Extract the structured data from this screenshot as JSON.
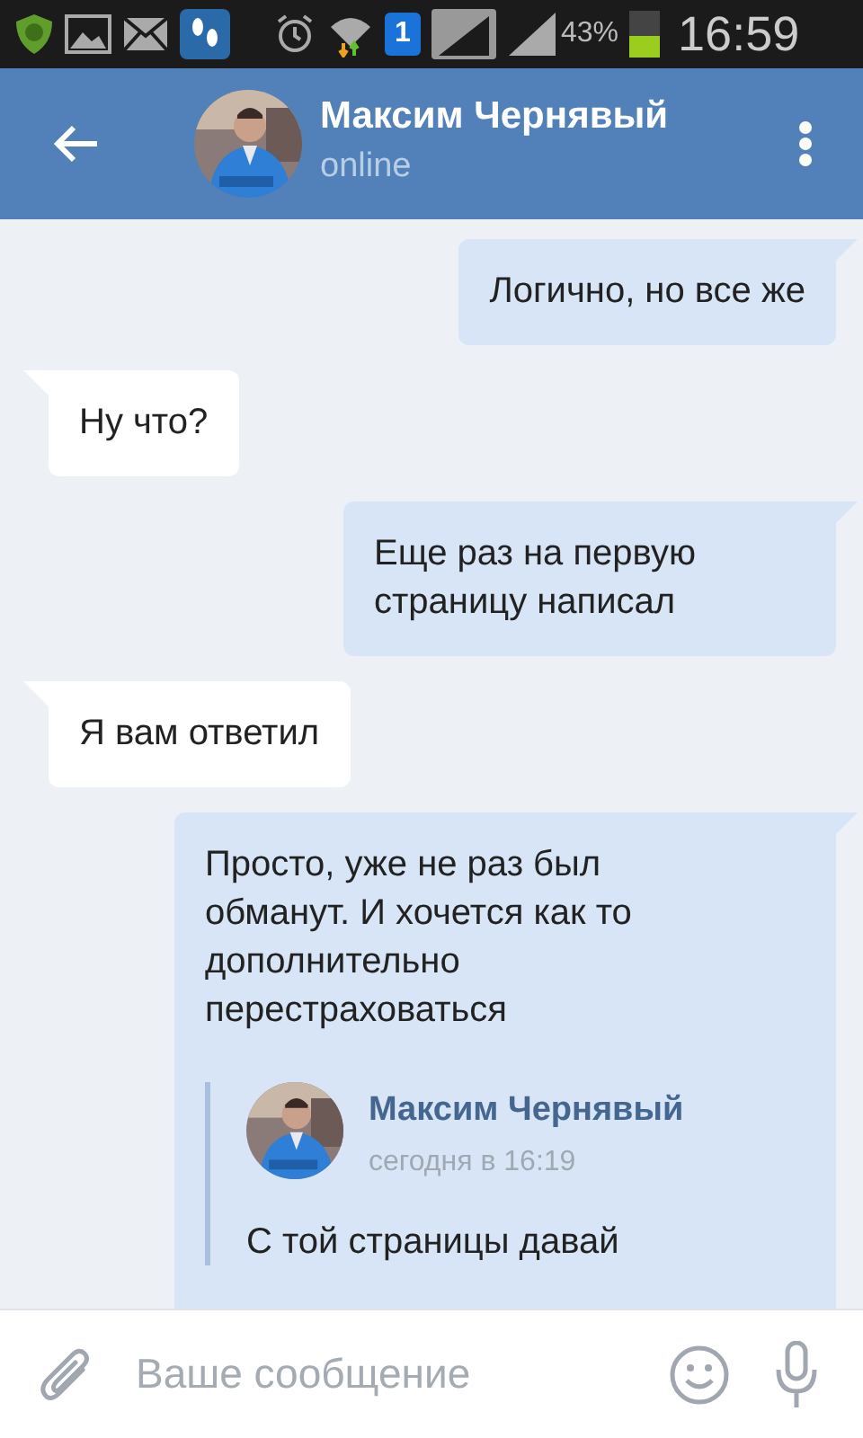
{
  "status_bar": {
    "sim_slot": "1",
    "battery_percent": "43%",
    "time": "16:59"
  },
  "header": {
    "title": "Максим Чернявый",
    "subtitle": "online"
  },
  "messages": [
    {
      "kind": "outgoing",
      "text": "Логично, но все же"
    },
    {
      "kind": "incoming",
      "text": "Ну что?"
    },
    {
      "kind": "outgoing",
      "text": "Еще раз на первую страницу написал"
    },
    {
      "kind": "incoming",
      "text": "Я вам ответил"
    },
    {
      "kind": "outgoing",
      "text": "Просто, уже не раз был обманут. И хочется как то дополнительно перестраховаться",
      "forwarded": {
        "author": "Максим Чернявый",
        "time": "сегодня в 16:19",
        "lines": [
          "С той страницы давай"
        ]
      }
    }
  ],
  "composer": {
    "placeholder": "Ваше сообщение"
  }
}
